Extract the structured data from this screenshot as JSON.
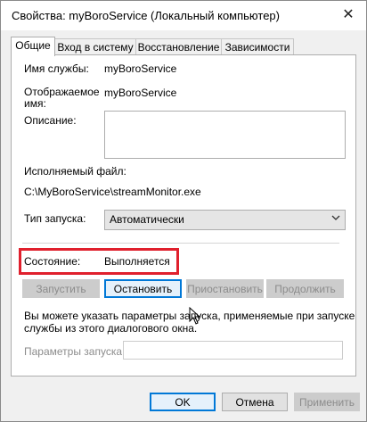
{
  "window": {
    "title": "Свойства: myBoroService (Локальный компьютер)",
    "close_glyph": "✕"
  },
  "tabs": [
    {
      "label": "Общие",
      "active": true
    },
    {
      "label": "Вход в систему",
      "active": false
    },
    {
      "label": "Восстановление",
      "active": false
    },
    {
      "label": "Зависимости",
      "active": false
    }
  ],
  "general": {
    "service_name_label": "Имя службы:",
    "service_name_value": "myBoroService",
    "display_name_label_line1": "Отображаемое",
    "display_name_label_line2": "имя:",
    "display_name_value": "myBoroService",
    "description_label": "Описание:",
    "description_value": "",
    "exe_label": "Исполняемый файл:",
    "exe_path": "C:\\MyBoroService\\streamMonitor.exe",
    "startup_type_label": "Тип запуска:",
    "startup_type_value": "Автоматически",
    "status_label": "Состояние:",
    "status_value": "Выполняется",
    "buttons": {
      "start": "Запустить",
      "stop": "Остановить",
      "pause": "Приостановить",
      "resume": "Продолжить"
    },
    "hint_line1": "Вы можете указать параметры запуска, применяемые при запуске",
    "hint_line2": "службы из этого диалогового окна.",
    "start_params_label": "Параметры запуска:",
    "start_params_value": ""
  },
  "footer": {
    "ok": "OK",
    "cancel": "Отмена",
    "apply": "Применить"
  },
  "colors": {
    "highlight_box": "#e0202d",
    "focus_border": "#0078d7"
  },
  "icons": {
    "close": "close-icon",
    "dropdown": "chevron-down-icon",
    "cursor": "mouse-pointer-icon"
  }
}
